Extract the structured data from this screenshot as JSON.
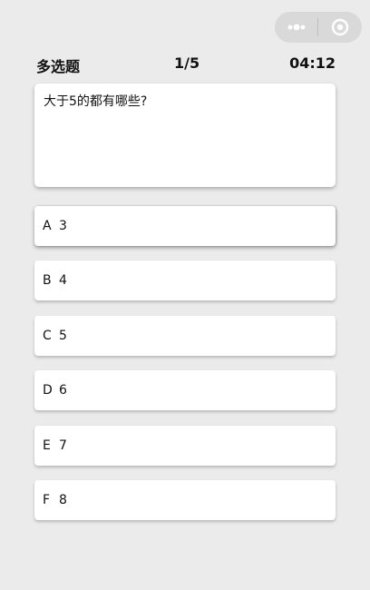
{
  "capsule": {
    "more_icon": "more-dots-icon",
    "close_icon": "target-circle-icon"
  },
  "header": {
    "question_type": "多选题",
    "progress": "1/5",
    "timer": "04:12"
  },
  "question": {
    "text": "大于5的都有哪些?"
  },
  "options": [
    {
      "letter": "A",
      "value": "3"
    },
    {
      "letter": "B",
      "value": "4"
    },
    {
      "letter": "C",
      "value": "5"
    },
    {
      "letter": "D",
      "value": "6"
    },
    {
      "letter": "E",
      "value": "7"
    },
    {
      "letter": "F",
      "value": "8"
    }
  ],
  "colors": {
    "background": "#ebebeb",
    "card": "#ffffff",
    "capsule": "#d9d9d9"
  }
}
